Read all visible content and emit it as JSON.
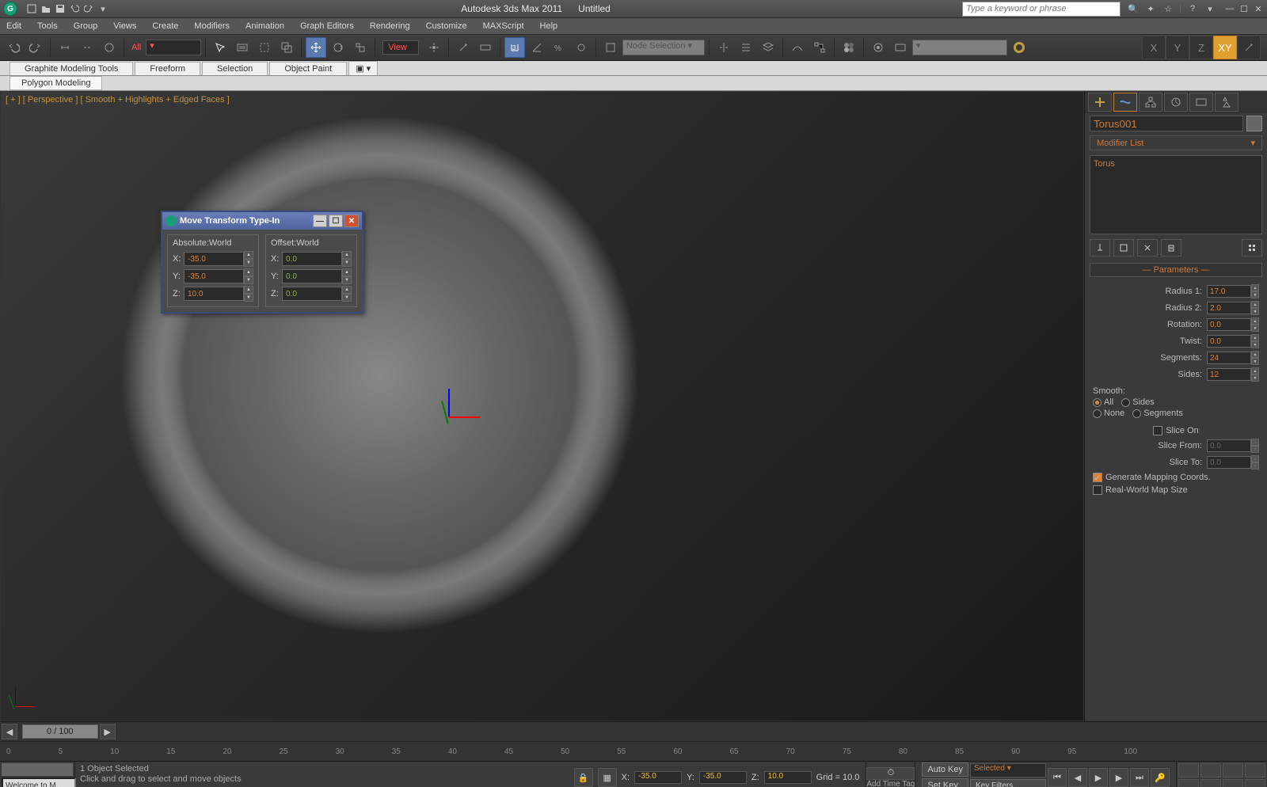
{
  "title_app": "Autodesk 3ds Max  2011",
  "title_doc": "Untitled",
  "search_placeholder": "Type a keyword or phrase",
  "menus": [
    "Edit",
    "Tools",
    "Group",
    "Views",
    "Create",
    "Modifiers",
    "Animation",
    "Graph Editors",
    "Rendering",
    "Customize",
    "MAXScript",
    "Help"
  ],
  "toolbar": {
    "all_label": "All",
    "view_label": "View",
    "named_sel": "Node Selection"
  },
  "axes": {
    "x": "X",
    "y": "Y",
    "z": "Z",
    "xy": "XY"
  },
  "ribbon_tabs": [
    "Graphite Modeling Tools",
    "Freeform",
    "Selection",
    "Object Paint"
  ],
  "ribbon_sub": "Polygon Modeling",
  "viewport_label": "[ + ] [ Perspective ] [ Smooth + Highlights + Edged Faces ]",
  "dialog": {
    "title": "Move Transform Type-In",
    "abs_title": "Absolute:World",
    "off_title": "Offset:World",
    "labels": {
      "x": "X:",
      "y": "Y:",
      "z": "Z:"
    },
    "abs": {
      "x": "-35.0",
      "y": "-35.0",
      "z": "10.0"
    },
    "off": {
      "x": "0.0",
      "y": "0.0",
      "z": "0.0"
    }
  },
  "cmd": {
    "object_name": "Torus001",
    "modifier_list": "Modifier List",
    "stack_item": "Torus",
    "rollout": "Parameters",
    "params": {
      "radius1": {
        "label": "Radius 1:",
        "value": "17.0"
      },
      "radius2": {
        "label": "Radius 2:",
        "value": "2.0"
      },
      "rotation": {
        "label": "Rotation:",
        "value": "0.0"
      },
      "twist": {
        "label": "Twist:",
        "value": "0.0"
      },
      "segments": {
        "label": "Segments:",
        "value": "24"
      },
      "sides": {
        "label": "Sides:",
        "value": "12"
      }
    },
    "smooth_label": "Smooth:",
    "smooth_opts": {
      "all": "All",
      "sides": "Sides",
      "none": "None",
      "segments": "Segments"
    },
    "slice_on": "Slice On",
    "slice_from": {
      "label": "Slice From:",
      "value": "0.0"
    },
    "slice_to": {
      "label": "Slice To:",
      "value": "0.0"
    },
    "gen_mapping": "Generate Mapping Coords.",
    "real_world": "Real-World Map Size"
  },
  "timeslider": "0 / 100",
  "track_ticks": [
    "0",
    "5",
    "10",
    "15",
    "20",
    "25",
    "30",
    "35",
    "40",
    "45",
    "50",
    "55",
    "60",
    "65",
    "70",
    "75",
    "80",
    "85",
    "90",
    "95",
    "100"
  ],
  "status": {
    "sel": "1 Object Selected",
    "prompt": "Click and drag to select and move objects",
    "maxscript": "Welcome to M.",
    "coords": {
      "x": "-35.0",
      "y": "-35.0",
      "z": "10.0"
    },
    "grid": "Grid = 10.0",
    "add_tag": "Add Time Tag",
    "auto_key": "Auto Key",
    "set_key": "Set Key",
    "sel_mode": "Selected",
    "key_filters": "Key Filters..."
  }
}
